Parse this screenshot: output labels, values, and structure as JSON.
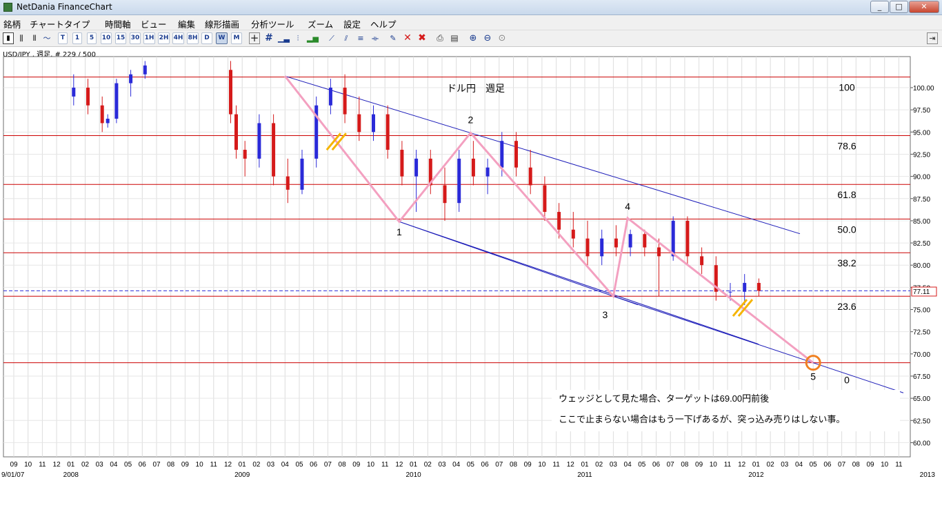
{
  "window": {
    "title": "NetDania FinanceChart",
    "min": "0",
    "max": "1",
    "close": "r"
  },
  "menu": [
    "銘柄",
    "チャートタイプ",
    "時間軸",
    "ビュー",
    "編集",
    "線形描画",
    "分析ツール",
    "ズーム",
    "設定",
    "ヘルプ"
  ],
  "toolbar": {
    "intervals": [
      "T",
      "1",
      "5",
      "10",
      "15",
      "30",
      "1H",
      "2H",
      "4H",
      "8H",
      "D",
      "W",
      "M"
    ],
    "selected_interval": "W"
  },
  "symbol_label": "USD/JPY , 週足, # 229 / 500",
  "colors": {
    "up": "#2a2ad8",
    "down": "#d51a1a",
    "fib": "#cc0000",
    "channel": "#1a1ab8",
    "wave": "#f3a0c0",
    "target": "#f08020",
    "hatch": "#f5b400"
  },
  "chart_data": {
    "type": "candlestick",
    "title": "ドル円　週足",
    "instrument": "USD/JPY",
    "interval": "週足",
    "ylim": [
      58.4,
      103.5
    ],
    "y_ticks": [
      100.0,
      97.5,
      95.0,
      92.5,
      90.0,
      87.5,
      85.0,
      82.5,
      80.0,
      77.5,
      75.0,
      72.5,
      70.0,
      67.5,
      65.0,
      62.5,
      60.0
    ],
    "current_price": 77.11,
    "x_month_labels": [
      "09",
      "10",
      "11",
      "12",
      "01",
      "02",
      "03",
      "04",
      "05",
      "06",
      "07",
      "08",
      "09",
      "10",
      "11",
      "12",
      "01",
      "02",
      "03",
      "04",
      "05",
      "06",
      "07",
      "08",
      "09",
      "10",
      "11",
      "12",
      "01",
      "02",
      "03",
      "04",
      "05",
      "06",
      "07",
      "08",
      "09",
      "10",
      "11",
      "12",
      "01",
      "02",
      "03",
      "04",
      "05",
      "06",
      "07",
      "08",
      "09",
      "10",
      "11",
      "12",
      "01",
      "02",
      "03",
      "04",
      "05",
      "06",
      "07",
      "08",
      "09",
      "10",
      "11",
      "12",
      "01",
      "02",
      "03",
      "04",
      "05",
      "06",
      "07",
      "08",
      "09",
      "10",
      "11"
    ],
    "x_year_labels": [
      {
        "label": "9/01/07",
        "month_index": 0
      },
      {
        "label": "2008",
        "month_index": 4
      },
      {
        "label": "2009",
        "month_index": 16
      },
      {
        "label": "2010",
        "month_index": 28
      },
      {
        "label": "2011",
        "month_index": 40
      },
      {
        "label": "2012",
        "month_index": 52
      },
      {
        "label": "2013",
        "month_index": 64
      }
    ],
    "fib_levels": [
      {
        "label": "100",
        "price": 101.2
      },
      {
        "label": "78.6",
        "price": 94.6
      },
      {
        "label": "61.8",
        "price": 89.1
      },
      {
        "label": "50.0",
        "price": 85.2
      },
      {
        "label": "38.2",
        "price": 81.4
      },
      {
        "label": "23.6",
        "price": 76.5
      },
      {
        "label": "0",
        "price": 69.0
      }
    ],
    "wave_points": [
      {
        "label": "",
        "date": "2009-04",
        "price": 101.3
      },
      {
        "label": "1",
        "date": "2009-12",
        "price": 84.9
      },
      {
        "label": "2",
        "date": "2010-05",
        "price": 94.9
      },
      {
        "label": "3",
        "date": "2011-03",
        "price": 76.5
      },
      {
        "label": "4",
        "date": "2011-04",
        "price": 85.3
      },
      {
        "label": "5",
        "date": "2012-05",
        "price": 69.0
      }
    ],
    "target": {
      "date": "2012-05",
      "price": 69.0
    },
    "candles": [
      {
        "t": "2008-01",
        "o": 99,
        "h": 101.5,
        "l": 98,
        "c": 100
      },
      {
        "t": "2008-02",
        "o": 100,
        "h": 101,
        "l": 97,
        "c": 98
      },
      {
        "t": "2008-03",
        "o": 98,
        "h": 99,
        "l": 95,
        "c": 96
      },
      {
        "t": "2008-03b",
        "o": 96,
        "h": 97,
        "l": 95.5,
        "c": 96.5
      },
      {
        "t": "2008-04",
        "o": 96.5,
        "h": 101,
        "l": 96,
        "c": 100.5
      },
      {
        "t": "2008-05",
        "o": 100.5,
        "h": 102,
        "l": 99,
        "c": 101.5
      },
      {
        "t": "2008-06",
        "o": 101.5,
        "h": 103,
        "l": 101,
        "c": 102.5
      },
      {
        "t": "2008-12",
        "o": 102,
        "h": 103,
        "l": 96,
        "c": 97
      },
      {
        "t": "2008-12b",
        "o": 97,
        "h": 98,
        "l": 92,
        "c": 93
      },
      {
        "t": "2009-01",
        "o": 93,
        "h": 94,
        "l": 90,
        "c": 92
      },
      {
        "t": "2009-02",
        "o": 92,
        "h": 97,
        "l": 91,
        "c": 96
      },
      {
        "t": "2009-03",
        "o": 96,
        "h": 97,
        "l": 89,
        "c": 90
      },
      {
        "t": "2009-04",
        "o": 90,
        "h": 92,
        "l": 87,
        "c": 88.5
      },
      {
        "t": "2009-05",
        "o": 88.5,
        "h": 93,
        "l": 88,
        "c": 92
      },
      {
        "t": "2009-06",
        "o": 92,
        "h": 99,
        "l": 91,
        "c": 98
      },
      {
        "t": "2009-07",
        "o": 98,
        "h": 101,
        "l": 97,
        "c": 100
      },
      {
        "t": "2009-08",
        "o": 100,
        "h": 101.5,
        "l": 96,
        "c": 97
      },
      {
        "t": "2009-09",
        "o": 97,
        "h": 99,
        "l": 94,
        "c": 95
      },
      {
        "t": "2009-10",
        "o": 95,
        "h": 98,
        "l": 94,
        "c": 97
      },
      {
        "t": "2009-11",
        "o": 97,
        "h": 98,
        "l": 92,
        "c": 93
      },
      {
        "t": "2009-12",
        "o": 93,
        "h": 94,
        "l": 89,
        "c": 90
      },
      {
        "t": "2010-01",
        "o": 90,
        "h": 93,
        "l": 86,
        "c": 92
      },
      {
        "t": "2010-02",
        "o": 92,
        "h": 93,
        "l": 88,
        "c": 89
      },
      {
        "t": "2010-03",
        "o": 89,
        "h": 91,
        "l": 85,
        "c": 87
      },
      {
        "t": "2010-04",
        "o": 87,
        "h": 93,
        "l": 86,
        "c": 92
      },
      {
        "t": "2010-05",
        "o": 92,
        "h": 94,
        "l": 89,
        "c": 90
      },
      {
        "t": "2010-06",
        "o": 90,
        "h": 92,
        "l": 88,
        "c": 91
      },
      {
        "t": "2010-07",
        "o": 91,
        "h": 95,
        "l": 90,
        "c": 94
      },
      {
        "t": "2010-08",
        "o": 94,
        "h": 95,
        "l": 90,
        "c": 91
      },
      {
        "t": "2010-09",
        "o": 91,
        "h": 93,
        "l": 88,
        "c": 89
      },
      {
        "t": "2010-10",
        "o": 89,
        "h": 90,
        "l": 85,
        "c": 86
      },
      {
        "t": "2010-11",
        "o": 86,
        "h": 87,
        "l": 83,
        "c": 84
      },
      {
        "t": "2010-12",
        "o": 84,
        "h": 86,
        "l": 82,
        "c": 83
      },
      {
        "t": "2011-01",
        "o": 83,
        "h": 85,
        "l": 80,
        "c": 81
      },
      {
        "t": "2011-02",
        "o": 81,
        "h": 84,
        "l": 80,
        "c": 83
      },
      {
        "t": "2011-03",
        "o": 83,
        "h": 84.5,
        "l": 81,
        "c": 82
      },
      {
        "t": "2011-04",
        "o": 82,
        "h": 84,
        "l": 81,
        "c": 83.5
      },
      {
        "t": "2011-05",
        "o": 83.5,
        "h": 84,
        "l": 81,
        "c": 82
      },
      {
        "t": "2011-06",
        "o": 82,
        "h": 83,
        "l": 76.5,
        "c": 81
      },
      {
        "t": "2011-07",
        "o": 81,
        "h": 85.5,
        "l": 80.5,
        "c": 85
      },
      {
        "t": "2011-08",
        "o": 85,
        "h": 85.5,
        "l": 80,
        "c": 81
      },
      {
        "t": "2011-09",
        "o": 81,
        "h": 82,
        "l": 79,
        "c": 80
      },
      {
        "t": "2011-10",
        "o": 80,
        "h": 81,
        "l": 76,
        "c": 77
      },
      {
        "t": "2011-11",
        "o": 77,
        "h": 78,
        "l": 76,
        "c": 77
      },
      {
        "t": "2011-12",
        "o": 77,
        "h": 79,
        "l": 75.5,
        "c": 78
      },
      {
        "t": "2012-01",
        "o": 78,
        "h": 78.5,
        "l": 76.5,
        "c": 77.11
      }
    ],
    "annotations": [
      "ウェッジとして見た場合、ターゲットは69.00円前後",
      "ここで止まらない場合はもう一下げあるが、突っ込み売りはしない事。"
    ]
  }
}
